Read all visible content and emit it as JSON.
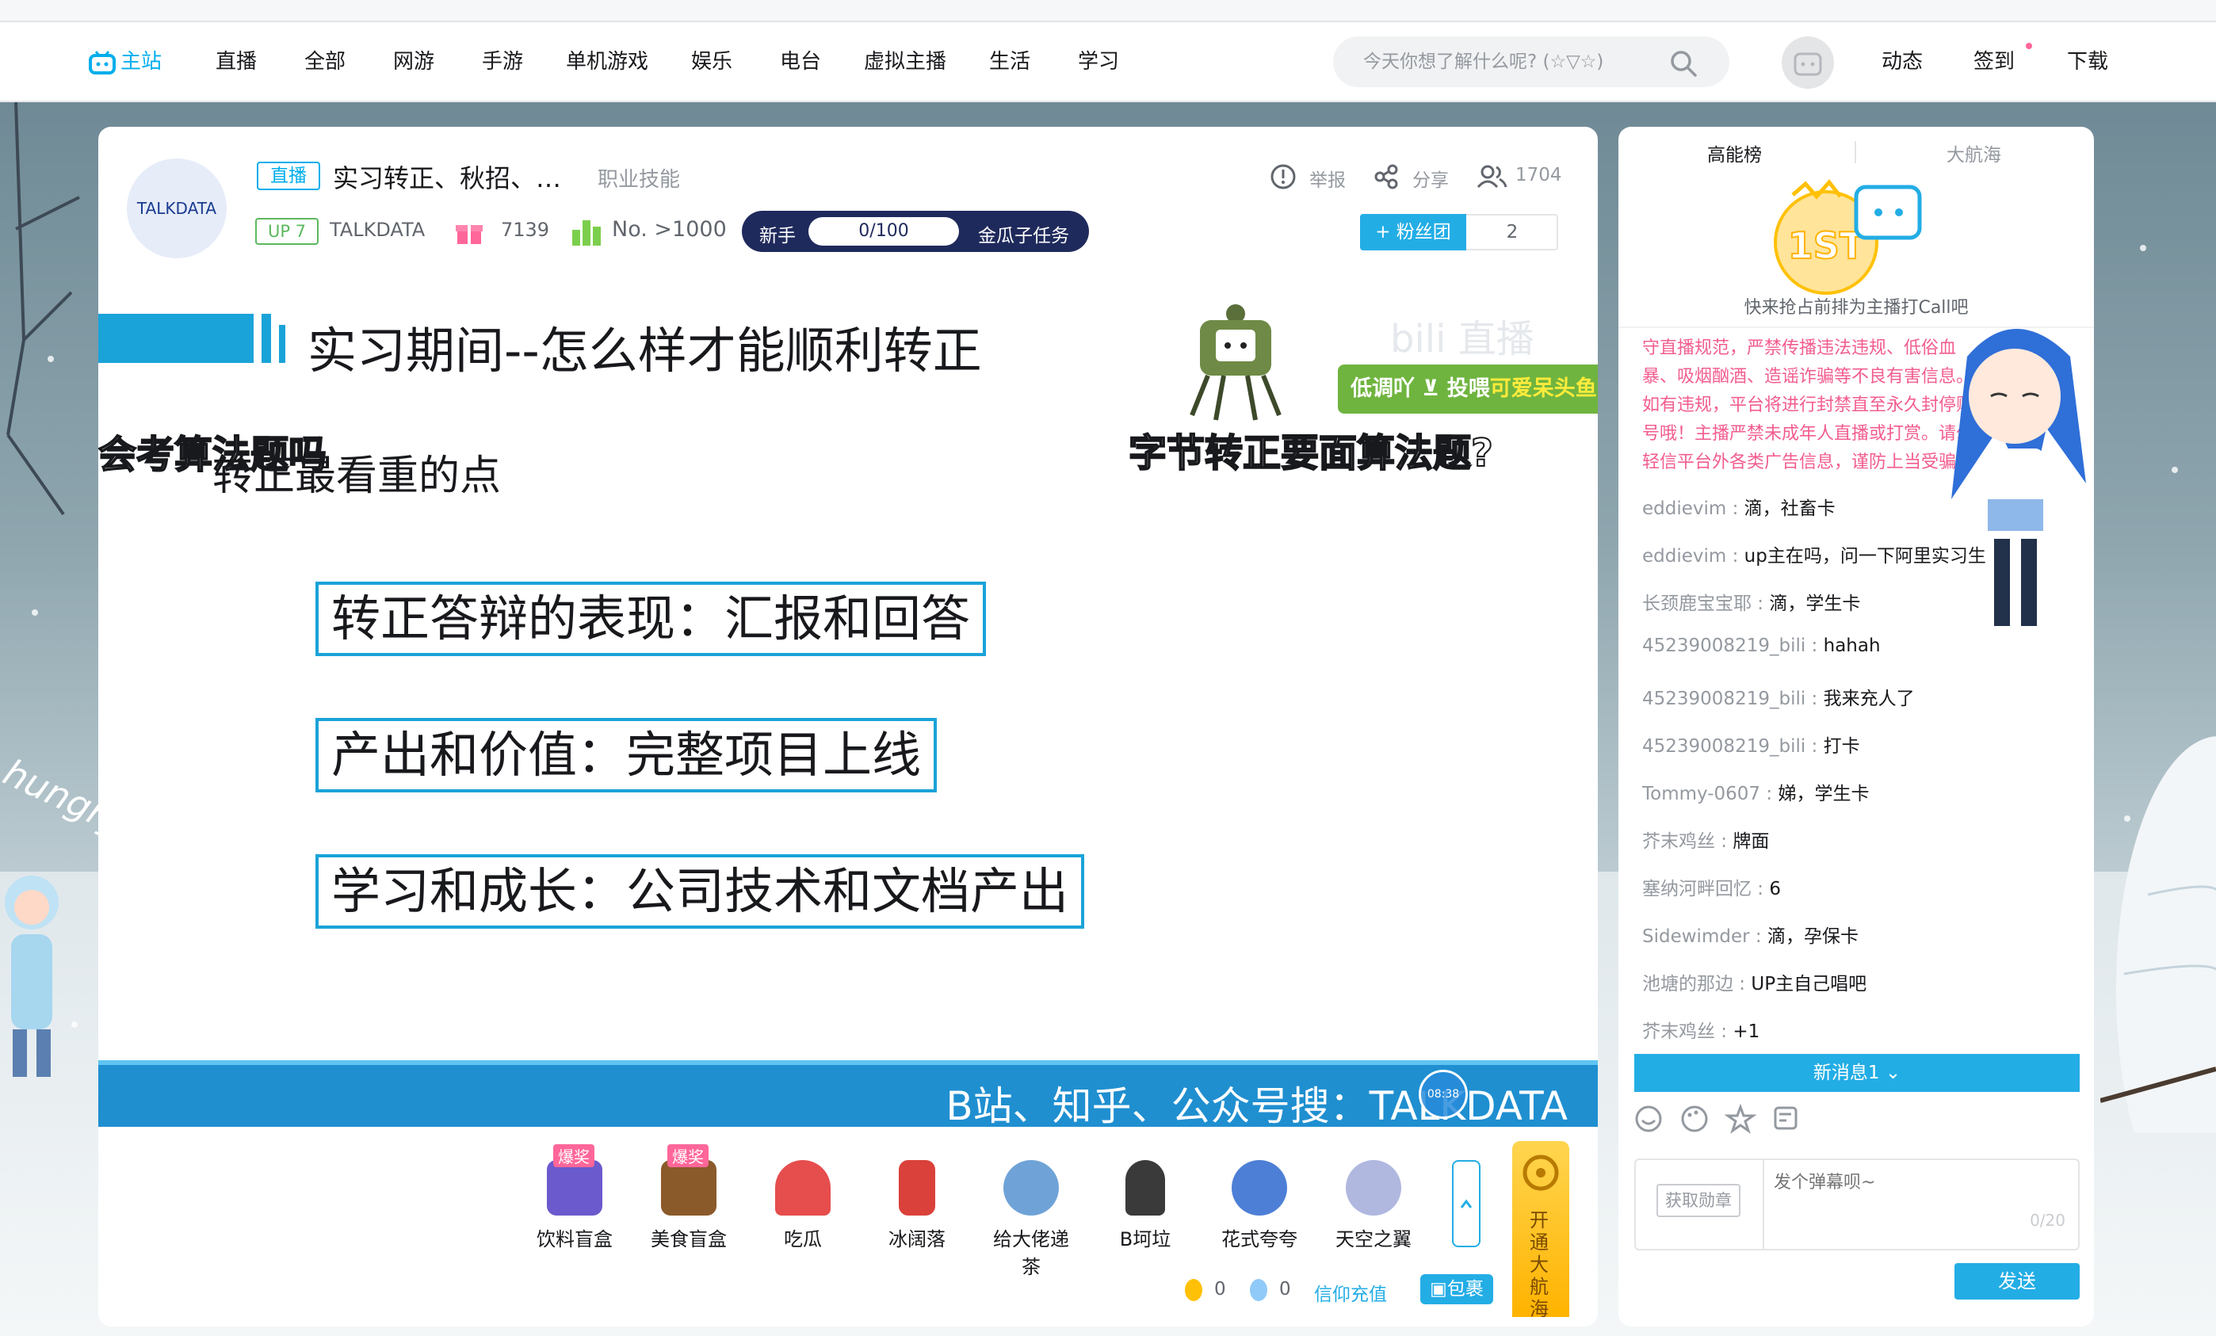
{
  "nav": {
    "home": "主站",
    "items": [
      "直播",
      "全部",
      "网游",
      "手游",
      "单机游戏",
      "娱乐",
      "电台",
      "虚拟主播",
      "生活",
      "学习"
    ],
    "search_placeholder": "今天你想了解什么呢? (☆▽☆)",
    "right": [
      "动态",
      "签到",
      "下载"
    ]
  },
  "room": {
    "avatar_text": "TALKDATA",
    "live_tag": "直播",
    "title": "实习转正、秋招、…",
    "category": "职业技能",
    "up_level": "UP 7",
    "up_name": "TALKDATA",
    "gift_count": "7139",
    "rank": "No. >1000",
    "task_left": "新手",
    "task_progress": "0/100",
    "task_right": "金瓜子任务",
    "report": "举报",
    "share": "分享",
    "viewers": "1704",
    "fan_btn": "+ 粉丝团",
    "fan_count": "2"
  },
  "slide": {
    "heading": "实习期间--怎么样才能顺利转正",
    "sub": "转正最看重的点",
    "danmaku1": "会考算法题吗",
    "danmaku2": "字节转正要面算法题?",
    "points": [
      "转正答辩的表现：汇报和回答",
      "产出和价值：完整项目上线",
      "学习和成长：公司技术和文档产出"
    ],
    "banner": "B站、知乎、公众号搜：TALKDATA",
    "feed_prompt": "低调吖 ⊻ 投喂",
    "feed_name": "可爱呆头鱼",
    "watermark": "bili 直播",
    "timer": "08:38"
  },
  "gifts": [
    {
      "name": "饮料盲盒",
      "badge": "爆奖",
      "color": "#6a5acd"
    },
    {
      "name": "美食盲盒",
      "badge": "爆奖",
      "color": "#8b5a2b"
    },
    {
      "name": "吃瓜",
      "badge": "",
      "color": "#e64d4d"
    },
    {
      "name": "冰阔落",
      "badge": "",
      "color": "#d9413a"
    },
    {
      "name": "给大佬递茶",
      "badge": "",
      "color": "#6fa3d8"
    },
    {
      "name": "B坷垃",
      "badge": "",
      "color": "#3a3a3a"
    },
    {
      "name": "花式夸夸",
      "badge": "",
      "color": "#4d7fd6"
    },
    {
      "name": "天空之翼",
      "badge": "",
      "color": "#b0b8e0"
    }
  ],
  "wallet": {
    "gold": "0",
    "silver": "0",
    "recharge": "信仰充值",
    "package": "包裹"
  },
  "guard": "开通大航海",
  "sidebar": {
    "tab1": "高能榜",
    "tab2": "大航海",
    "rank_badge": "1ST",
    "rank_hint": "快来抢占前排为主播打Call吧",
    "notice": "守直播规范，严禁传播违法违规、低俗血暴、吸烟酗酒、造谣诈骗等不良有害信息。如有违规，平台将进行封禁直至永久封停账号哦！主播严禁未成年人直播或打赏。请勿轻信平台外各类广告信息，谨防上当受骗。",
    "chats": [
      {
        "user": "eddievim",
        "msg": "滴，社畜卡"
      },
      {
        "user": "eddievim",
        "msg": "up主在吗，问一下阿里实习生"
      },
      {
        "user": "长颈鹿宝宝耶",
        "msg": "滴，学生卡"
      },
      {
        "user": "45239008219_bili",
        "msg": "hahah"
      },
      {
        "user": "45239008219_bili",
        "msg": "我来充人了"
      },
      {
        "user": "45239008219_bili",
        "msg": "打卡"
      },
      {
        "user": "Tommy-0607",
        "msg": "娣，学生卡"
      },
      {
        "user": "芥末鸡丝",
        "msg": "牌面"
      },
      {
        "user": "塞纳河畔回忆",
        "msg": "6"
      },
      {
        "user": "Sidewimder",
        "msg": "滴，孕保卡"
      },
      {
        "user": "池塘的那边",
        "msg": "UP主自己唱吧"
      },
      {
        "user": "芥末鸡丝",
        "msg": "+1"
      }
    ],
    "new_msg": "新消息1",
    "medal_btn": "获取勋章",
    "input_placeholder": "发个弹幕呗~",
    "counter": "0/20",
    "send": "发送"
  },
  "scene_text": "hungry",
  "colors": {
    "accent": "#00aeec",
    "pink": "#ff6699",
    "blue": "#1aa3d8",
    "dark": "#1f2a5c"
  }
}
